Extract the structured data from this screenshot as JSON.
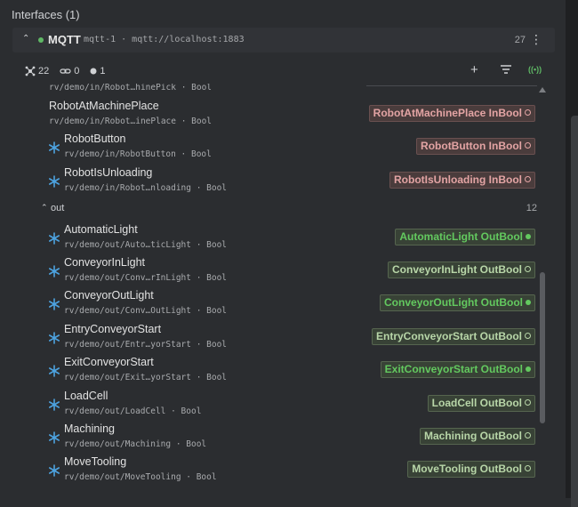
{
  "title": "Interfaces (1)",
  "interface": {
    "name": "MQTT",
    "subtitle": "mqtt-1 · mqtt://localhost:1883",
    "count": "27",
    "status_color": "#5fb865"
  },
  "stats": {
    "nodes": "22",
    "links": "0",
    "dots": "1"
  },
  "toolbar": {
    "add": "+",
    "filter": "≡",
    "broadcast": "((•))"
  },
  "partial_row_path": "rv/demo/in/Robot…hinePick · Bool",
  "in_rows": [
    {
      "name": "RobotAtMachinePlace",
      "path": "rv/demo/in/Robot…inePlace · Bool",
      "tag": "RobotAtMachinePlace InBool",
      "icon": false
    },
    {
      "name": "RobotButton",
      "path": "rv/demo/in/RobotButton · Bool",
      "tag": "RobotButton InBool",
      "icon": true
    },
    {
      "name": "RobotIsUnloading",
      "path": "rv/demo/in/Robot…nloading · Bool",
      "tag": "RobotIsUnloading InBool",
      "icon": true
    }
  ],
  "out_group": {
    "name": "out",
    "count": "12"
  },
  "out_rows": [
    {
      "name": "AutomaticLight",
      "path": "rv/demo/out/Auto…ticLight · Bool",
      "tag": "AutomaticLight OutBool",
      "active": true
    },
    {
      "name": "ConveyorInLight",
      "path": "rv/demo/out/Conv…rInLight · Bool",
      "tag": "ConveyorInLight OutBool",
      "active": false
    },
    {
      "name": "ConveyorOutLight",
      "path": "rv/demo/out/Conv…OutLight · Bool",
      "tag": "ConveyorOutLight OutBool",
      "active": true
    },
    {
      "name": "EntryConveyorStart",
      "path": "rv/demo/out/Entr…yorStart · Bool",
      "tag": "EntryConveyorStart OutBool",
      "active": false
    },
    {
      "name": "ExitConveyorStart",
      "path": "rv/demo/out/Exit…yorStart · Bool",
      "tag": "ExitConveyorStart OutBool",
      "active": true
    },
    {
      "name": "LoadCell",
      "path": "rv/demo/out/LoadCell · Bool",
      "tag": "LoadCell OutBool",
      "active": false
    },
    {
      "name": "Machining",
      "path": "rv/demo/out/Machining · Bool",
      "tag": "Machining OutBool",
      "active": false
    },
    {
      "name": "MoveTooling",
      "path": "rv/demo/out/MoveTooling · Bool",
      "tag": "MoveTooling OutBool",
      "active": false
    }
  ],
  "colors": {
    "accent_green": "#5fb865",
    "active_green": "#63c95f",
    "in_text": "#e3a4a4",
    "snowflake": "#4da3e0"
  }
}
